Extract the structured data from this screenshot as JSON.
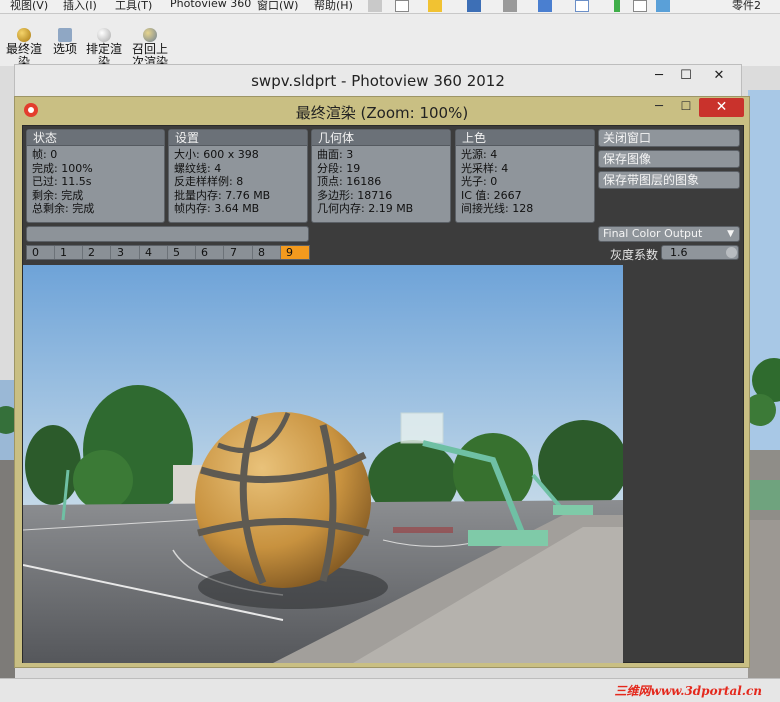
{
  "solidworks": {
    "menu": [
      "视图(V)",
      "插入(I)",
      "工具(T)",
      "Photoview 360",
      "窗口(W)",
      "帮助(H)"
    ],
    "right_label": "零件2",
    "ribbon": {
      "final_render": "最终渲染",
      "options": "选项",
      "schedule_render": "排定渲染",
      "recall_last": "召回上次渲染"
    }
  },
  "outer_window": {
    "title": "swpv.sldprt - Photoview 360 2012",
    "min": "─",
    "max": "☐",
    "close": "✕"
  },
  "render_window": {
    "title": "最终渲染 (Zoom: 100%)",
    "min": "─",
    "max": "☐",
    "close": "✕",
    "panels": {
      "status": {
        "header": "状态",
        "rows": [
          "帧: 0",
          "完成: 100%",
          "已过: 11.5s",
          "剩余: 完成",
          "总剩余: 完成"
        ]
      },
      "settings": {
        "header": "设置",
        "rows": [
          "大小: 600 x 398",
          "螺纹线: 4",
          "反走样样例: 8",
          "批量内存: 7.76 MB",
          "帧内存: 3.64 MB"
        ]
      },
      "geometry": {
        "header": "几何体",
        "rows": [
          "曲面: 3",
          "分段: 19",
          "顶点: 16186",
          "多边形: 18716",
          "几何内存: 2.19 MB"
        ]
      },
      "shading": {
        "header": "上色",
        "rows": [
          "光源: 4",
          "光采样: 4",
          "光子: 0",
          "IC 值: 2667",
          "间接光线: 128"
        ]
      }
    },
    "buttons": {
      "close_window": "关闭窗口",
      "save_image": "保存图像",
      "save_image_layers": "保存带图层的图象"
    },
    "output_select": {
      "value": "Final Color Output"
    },
    "gamma": {
      "label": "灰度系数",
      "value": "1.6"
    },
    "passes": [
      "0",
      "1",
      "2",
      "3",
      "4",
      "5",
      "6",
      "7",
      "8",
      "9"
    ],
    "active_pass": "9"
  },
  "watermark": "三维网www.3dportal.cn",
  "colors": {
    "window_frame": "#c9bf83",
    "panel": "#8f959b",
    "content_bg": "#3c3c3c",
    "active_pass": "#f39a1e",
    "close_red": "#c9322c"
  }
}
